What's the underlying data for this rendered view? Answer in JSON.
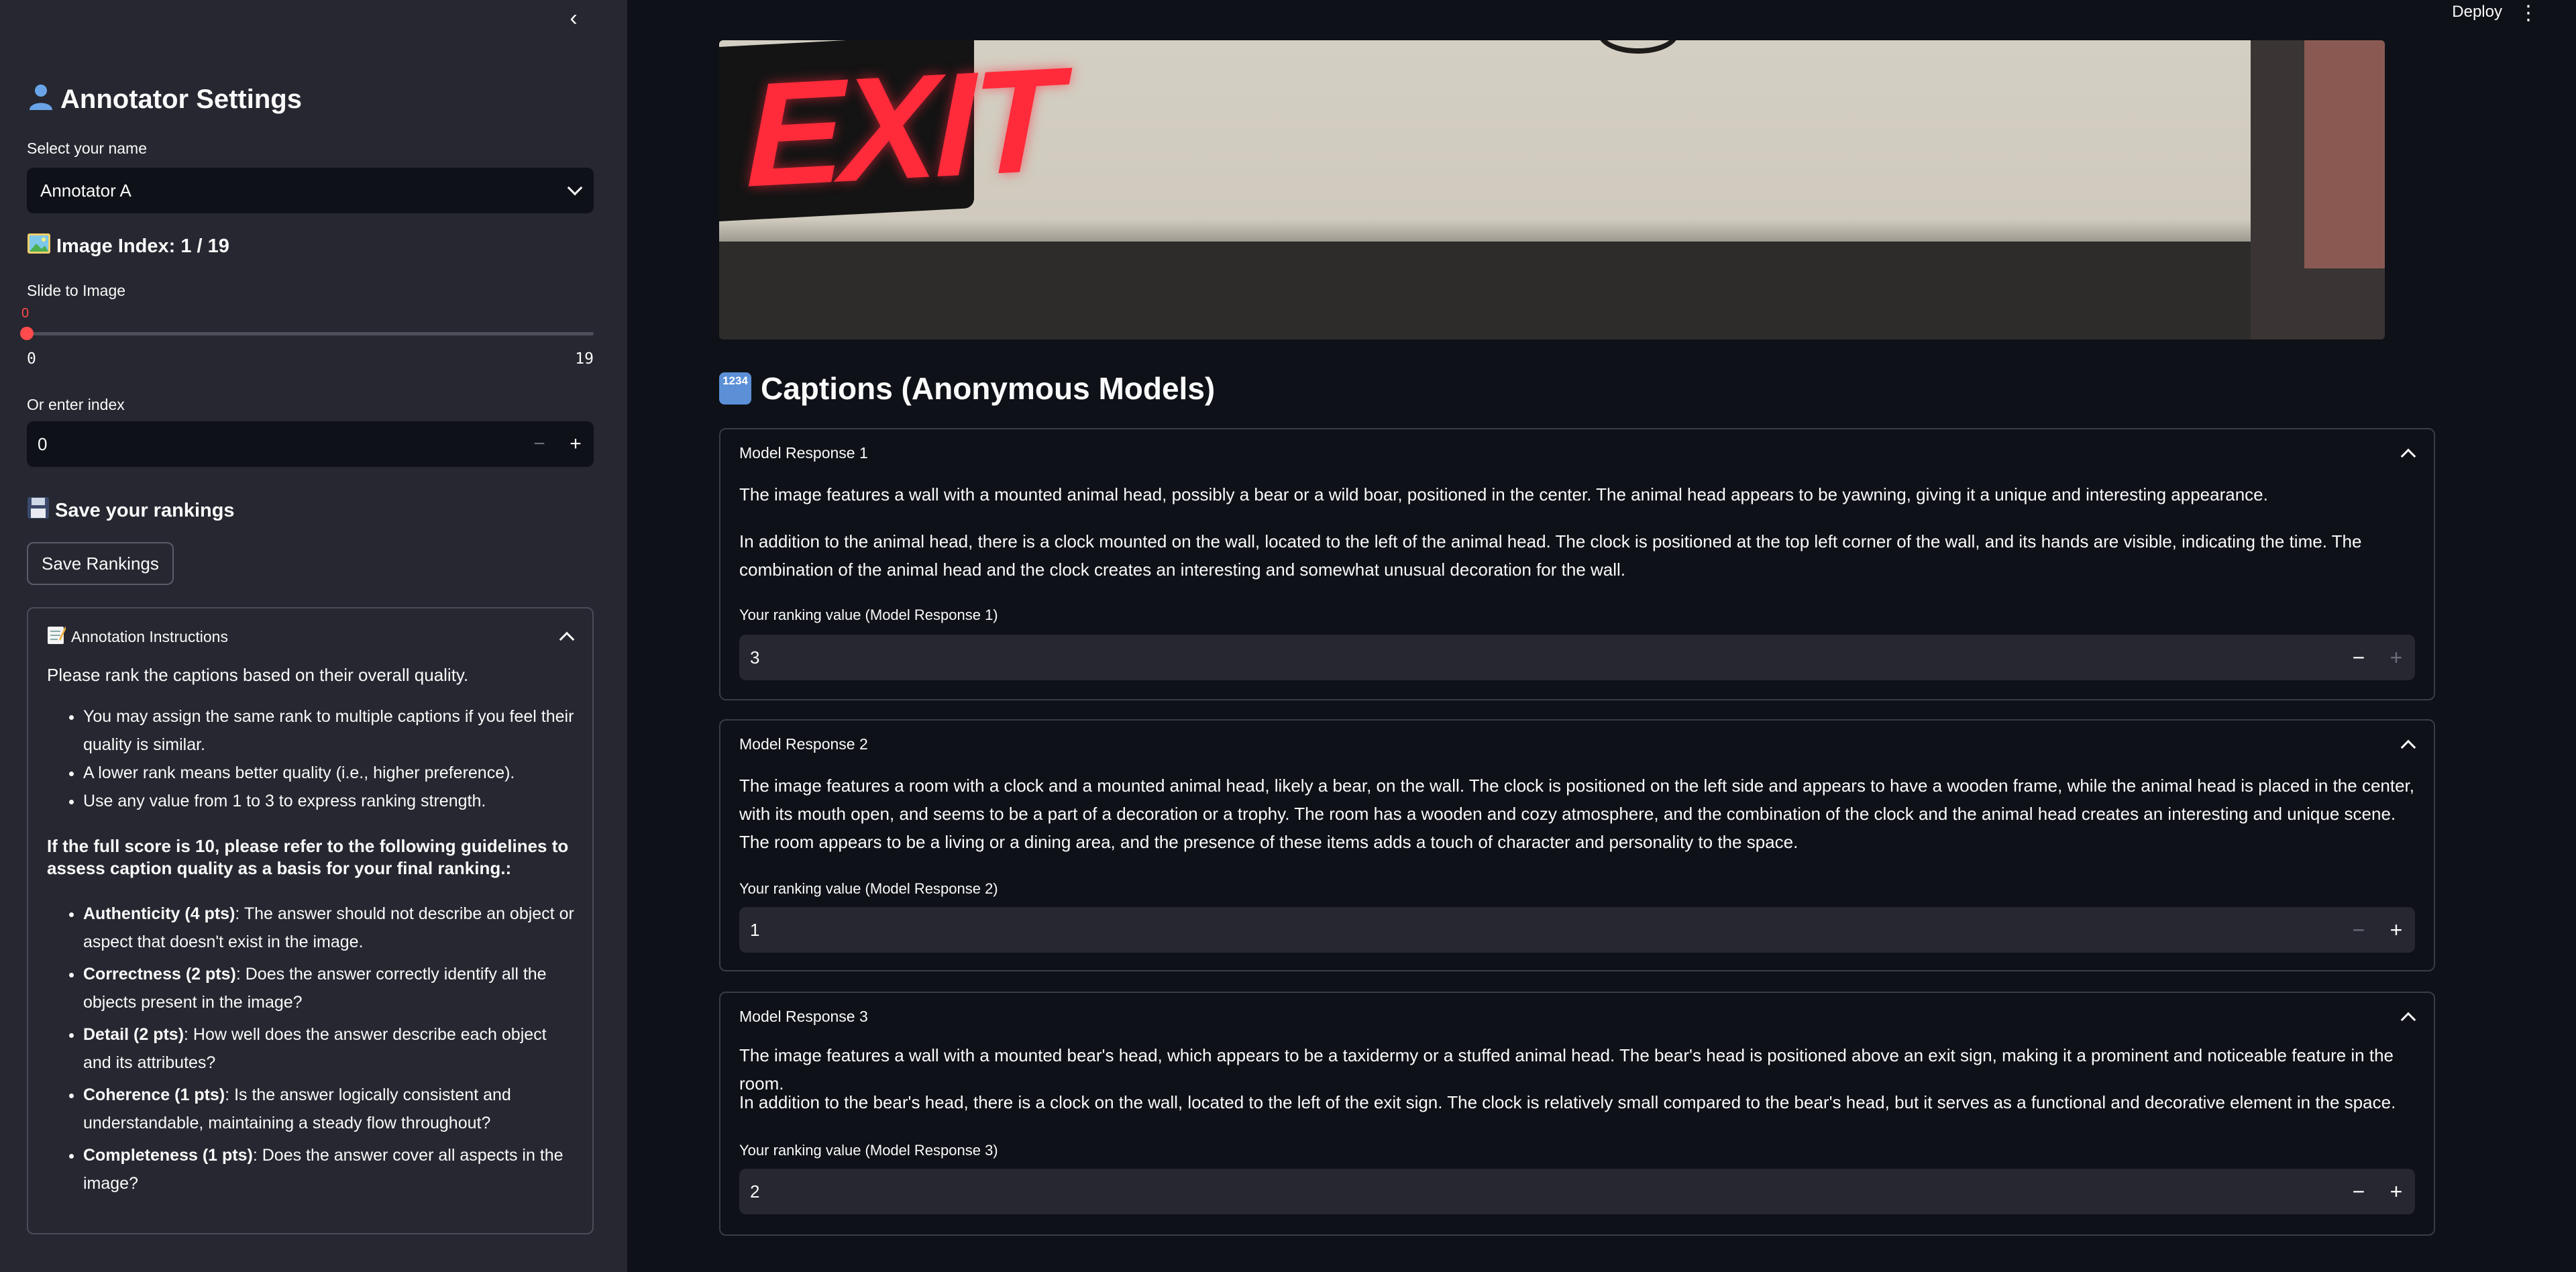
{
  "sidebar": {
    "title": "Annotator Settings",
    "title_icon": "person-icon",
    "select_label": "Select your name",
    "select_value": "Annotator A",
    "image_index_icon": "picture-icon",
    "image_index_text": "Image Index: 1 / 19",
    "slider_label": "Slide to Image",
    "slider_value": "0",
    "slider_min": "0",
    "slider_max": "19",
    "slider_fraction": 0,
    "index_label": "Or enter index",
    "index_value": "0",
    "save_heading": "Save your rankings",
    "save_icon": "floppy-disk-icon",
    "save_button": "Save Rankings",
    "instructions": {
      "title": "Annotation Instructions",
      "icon": "memo-icon",
      "intro": "Please rank the captions based on their overall quality.",
      "bullets": [
        "You may assign the same rank to multiple captions if you feel their quality is similar.",
        "A lower rank means better quality (i.e., higher preference).",
        "Use any value from 1 to 3 to express ranking strength."
      ],
      "guideline_heading": "If the full score is 10, please refer to the following guidelines to assess caption quality as a basis for your final ranking.:",
      "criteria": [
        {
          "name": "Authenticity (4 pts)",
          "text": ": The answer should not describe an object or aspect that doesn't exist in the image."
        },
        {
          "name": "Correctness (2 pts)",
          "text": ": Does the answer correctly identify all the objects present in the image?"
        },
        {
          "name": "Detail (2 pts)",
          "text": ": How well does the answer describe each object and its attributes?"
        },
        {
          "name": "Coherence (1 pts)",
          "text": ": Is the answer logically consistent and understandable, maintaining a steady flow throughout?"
        },
        {
          "name": "Completeness (1 pts)",
          "text": ": Does the answer cover all aspects in the image?"
        }
      ]
    }
  },
  "header": {
    "deploy": "Deploy"
  },
  "main": {
    "image_sign_text": "EXIT",
    "captions_heading": "Captions (Anonymous Models)",
    "captions_icon": "1234",
    "responses": [
      {
        "title": "Model Response 1",
        "paragraphs": [
          "The image features a wall with a mounted animal head, possibly a bear or a wild boar, positioned in the center. The animal head appears to be yawning, giving it a unique and interesting appearance.",
          "In addition to the animal head, there is a clock mounted on the wall, located to the left of the animal head. The clock is positioned at the top left corner of the wall, and its hands are visible, indicating the time. The combination of the animal head and the clock creates an interesting and somewhat unusual decoration for the wall."
        ],
        "rank_label": "Your ranking value (Model Response 1)",
        "rank_value": "3"
      },
      {
        "title": "Model Response 2",
        "paragraphs": [
          "The image features a room with a clock and a mounted animal head, likely a bear, on the wall. The clock is positioned on the left side and appears to have a wooden frame, while the animal head is placed in the center, with its mouth open, and seems to be a part of a decoration or a trophy. The room has a wooden and cozy atmosphere, and the combination of the clock and the animal head creates an interesting and unique scene. The room appears to be a living or a dining area, and the presence of these items adds a touch of character and personality to the space."
        ],
        "rank_label": "Your ranking value (Model Response 2)",
        "rank_value": "1"
      },
      {
        "title": "Model Response 3",
        "paragraphs": [
          "The image features a wall with a mounted bear's head, which appears to be a taxidermy or a stuffed animal head. The bear's head is positioned above an exit sign, making it a prominent and noticeable feature in the room.",
          "In addition to the bear's head, there is a clock on the wall, located to the left of the exit sign. The clock is relatively small compared to the bear's head, but it serves as a functional and decorative element in the space."
        ],
        "rank_label": "Your ranking value (Model Response 3)",
        "rank_value": "2"
      }
    ]
  },
  "colors": {
    "accent": "#ff4b4b",
    "background": "#0e1117",
    "sidebar": "#262730"
  }
}
